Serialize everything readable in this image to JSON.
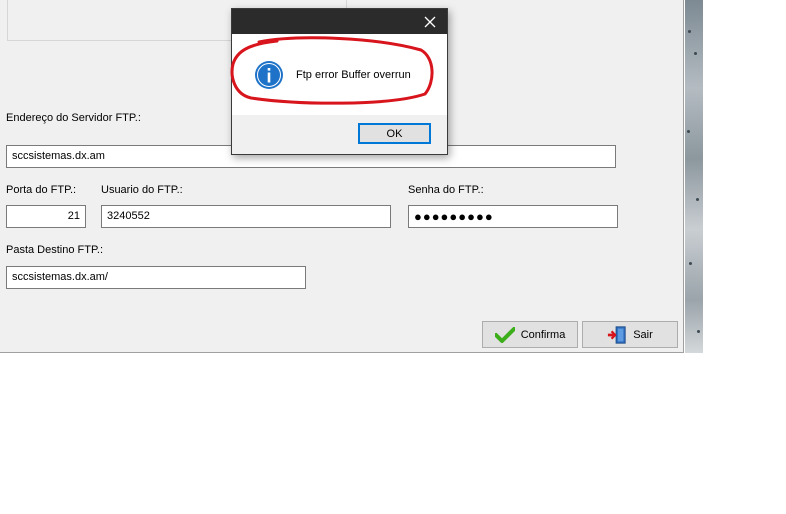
{
  "form": {
    "server_label": "Endereço do Servidor FTP.:",
    "server_value": "sccsistemas.dx.am",
    "port_label": "Porta do FTP.:",
    "port_value": "21",
    "user_label": "Usuario do FTP.:",
    "user_value": "3240552",
    "password_label": "Senha do FTP.:",
    "password_value": "●●●●●●●●●",
    "folder_label": "Pasta Destino FTP.:",
    "folder_value": "sccsistemas.dx.am/"
  },
  "buttons": {
    "confirm_label": "Confirma",
    "exit_label": "Sair"
  },
  "dialog": {
    "close_glyph": "✕",
    "message": "Ftp error Buffer overrun",
    "ok_label": "OK"
  },
  "icons": {
    "dialog": "information-icon",
    "confirm": "green-checkmark-icon",
    "exit": "exit-door-icon",
    "close": "close-icon"
  },
  "colors": {
    "info_icon": "#1e73c8",
    "checkmark": "#3cae1a",
    "annotation": "#d8141c",
    "ok_focus": "#0078d7",
    "titlebar": "#2b2b2b"
  }
}
